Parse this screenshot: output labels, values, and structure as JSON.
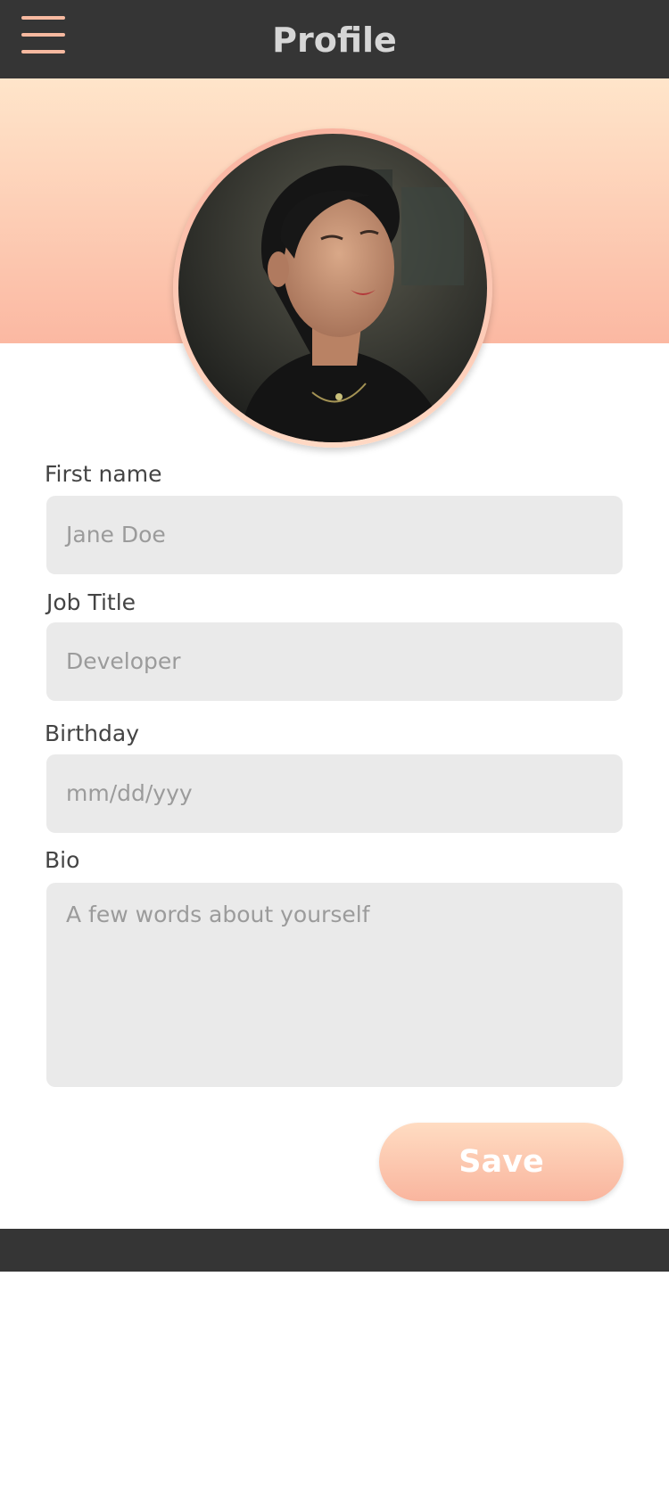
{
  "header": {
    "title": "Profile",
    "menu_icon": "hamburger-menu-icon"
  },
  "profile": {
    "avatar": "profile-photo"
  },
  "form": {
    "first_name": {
      "label": "First name",
      "placeholder": "Jane Doe"
    },
    "job_title": {
      "label": "Job Title",
      "placeholder": "Developer"
    },
    "birthday": {
      "label": "Birthday",
      "placeholder": "mm/dd/yyy"
    },
    "bio": {
      "label": "Bio",
      "placeholder": "A few words about yourself"
    }
  },
  "actions": {
    "save_label": "Save"
  },
  "colors": {
    "bar": "#353535",
    "accent_light": "#ffe5ca",
    "accent": "#fbb8a2",
    "field_bg": "#eaeaea"
  }
}
